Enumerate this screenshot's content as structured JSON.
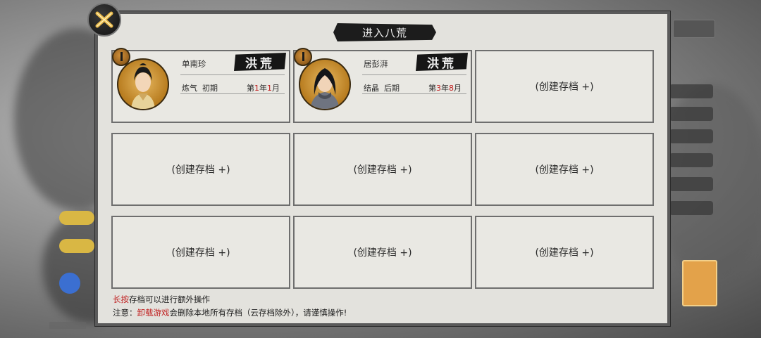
{
  "dialog": {
    "title": "进入八荒",
    "close_icon": "crossed-swords-icon"
  },
  "saves": [
    {
      "name": "单南珍",
      "seal_text": "洪荒",
      "realm": "炼气",
      "stage": "初期",
      "date": {
        "prefix": "第",
        "year": "1",
        "year_unit": "年",
        "month": "1",
        "month_unit": "月"
      }
    },
    {
      "name": "居彭湃",
      "seal_text": "洪荒",
      "realm": "结晶",
      "stage": "后期",
      "date": {
        "prefix": "第",
        "year": "3",
        "year_unit": "年",
        "month": "8",
        "month_unit": "月"
      }
    }
  ],
  "empty_slot_label": "(创建存档 +)",
  "notes": {
    "line1_highlight": "长按",
    "line1_rest": "存档可以进行额外操作",
    "line2_prefix": "注意：",
    "line2_highlight": "卸载游戏",
    "line2_rest": "会删除本地所有存档（云存档除外），请谨慎操作!"
  },
  "colors": {
    "highlight_red": "#c02020",
    "dialog_bg": "#e3e2dd",
    "banner_bg": "#1c1c1c"
  }
}
